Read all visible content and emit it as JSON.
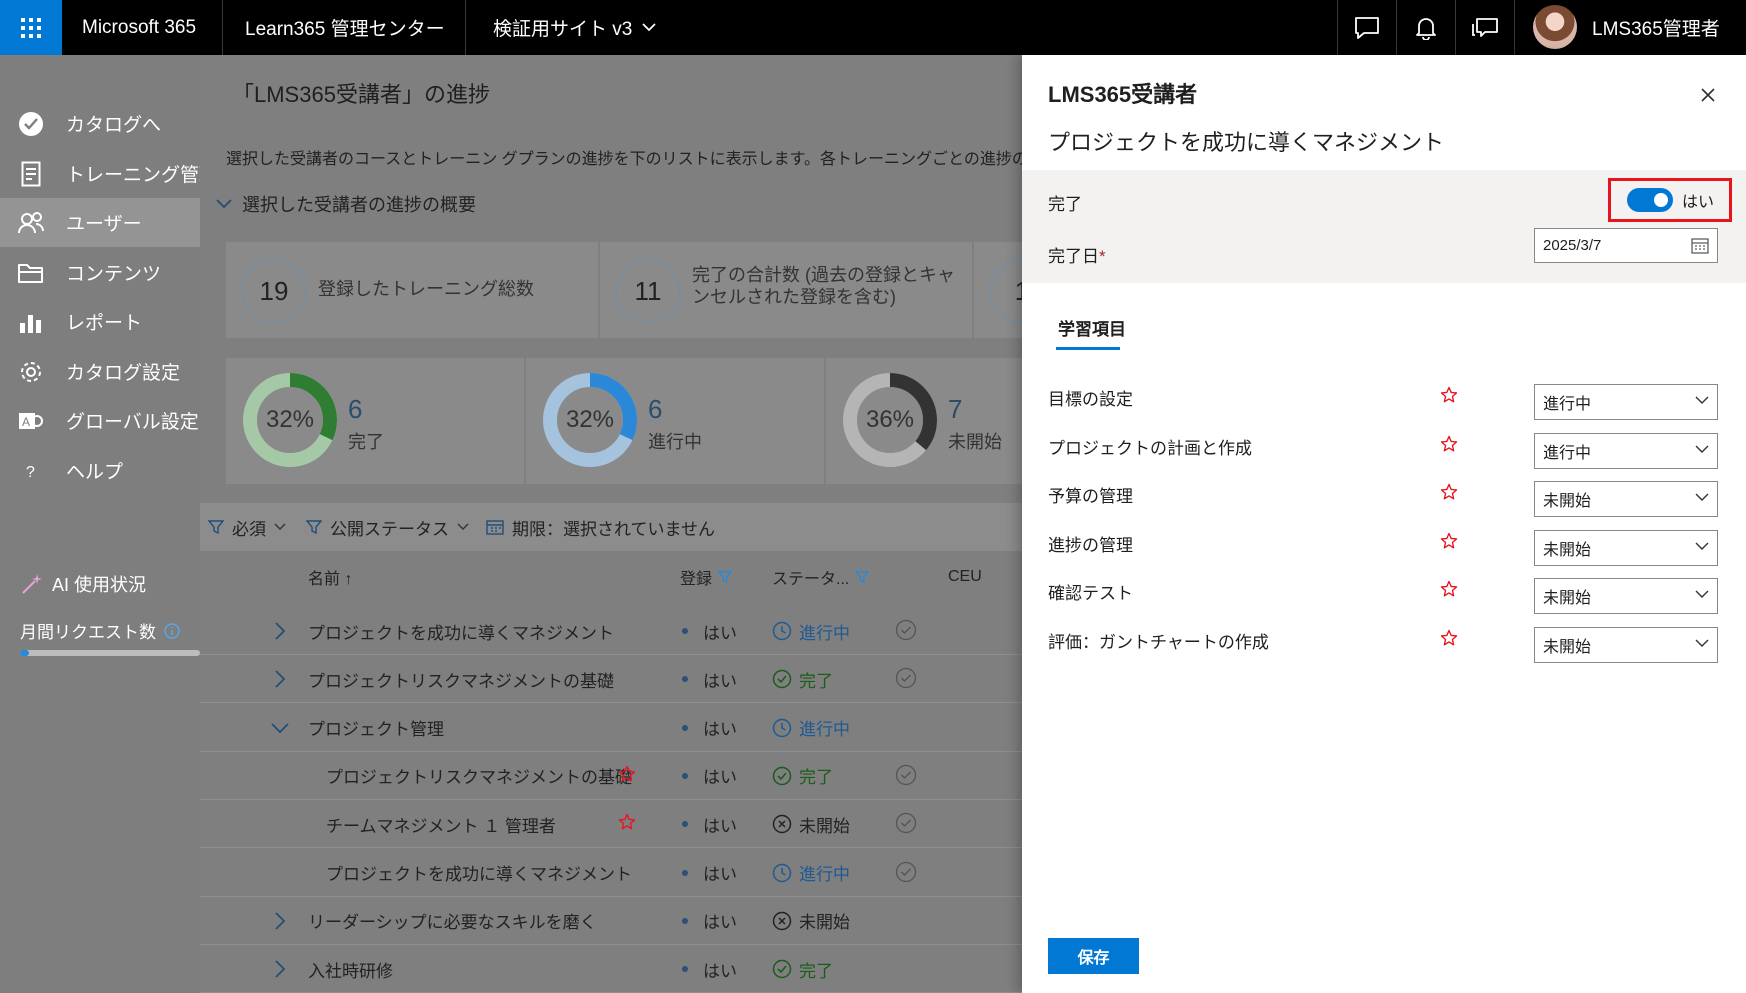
{
  "topbar": {
    "brand": "Microsoft 365",
    "app": "Learn365 管理センター",
    "site": "検証用サイト v3",
    "user": "LMS365管理者",
    "icons": [
      "waffle-icon",
      "chat-icon",
      "bell-icon",
      "feedback-icon"
    ]
  },
  "nav": {
    "items": [
      {
        "label": "カタログへ",
        "icon": "check-circle-icon"
      },
      {
        "label": "トレーニング管理",
        "icon": "document-icon"
      },
      {
        "label": "ユーザー",
        "icon": "users-icon"
      },
      {
        "label": "コンテンツ",
        "icon": "folder-icon"
      },
      {
        "label": "レポート",
        "icon": "bar-chart-icon"
      },
      {
        "label": "カタログ設定",
        "icon": "gear-icon"
      },
      {
        "label": "グローバル設定",
        "icon": "global-settings-icon"
      },
      {
        "label": "ヘルプ",
        "icon": "help-icon"
      }
    ],
    "ai_usage": "AI 使用状況",
    "monthly_requests": "月間リクエスト数",
    "monthly_requests_fraction": 0.05
  },
  "main": {
    "title": "「LMS365受講者」の進捗",
    "description": "選択した受講者のコースとトレーニン グプランの進捗を下のリストに表示します。各トレーニングごとの進捗の詳",
    "summary_toggle": "選択した受講者の進捗の概要",
    "stats": [
      {
        "value": "19",
        "label_line1": "登録したトレーニング総数",
        "label_line2": ""
      },
      {
        "value": "11",
        "label_line1": "完了の合計数 (過去の登録とキャ",
        "label_line2": "ンセルされた登録を含む)"
      },
      {
        "value": "1",
        "label_line1": "",
        "label_line2": ""
      }
    ],
    "donuts": [
      {
        "pct": "32%",
        "fraction": 0.32,
        "value": "6",
        "label": "完了",
        "color": "#2e7d32",
        "track": "#a5c9a7"
      },
      {
        "pct": "32%",
        "fraction": 0.32,
        "value": "6",
        "label": "進行中",
        "color": "#2b88d8",
        "track": "#a6c3dd"
      },
      {
        "pct": "36%",
        "fraction": 0.36,
        "value": "7",
        "label": "未開始",
        "color": "#333333",
        "track": "#b5b5b5"
      }
    ],
    "filters": {
      "required": "必須",
      "publish_status": "公開ステータス",
      "due": "期限：選択されていません"
    },
    "columns": {
      "name": "名前 ↑",
      "registered": "登録",
      "status": "ステータ...",
      "ceu": "CEU"
    },
    "rows": [
      {
        "name": "プロジェクトを成功に導くマネジメント",
        "registered": "はい",
        "status": "進行中",
        "status_type": "inprogress",
        "expand": "collapsed",
        "indent": 0,
        "star": false,
        "ceu": true
      },
      {
        "name": "プロジェクトリスクマネジメントの基礎",
        "registered": "はい",
        "status": "完了",
        "status_type": "complete",
        "expand": "collapsed",
        "indent": 0,
        "star": false,
        "ceu": true
      },
      {
        "name": "プロジェクト管理",
        "registered": "はい",
        "status": "進行中",
        "status_type": "inprogress",
        "expand": "expanded",
        "indent": 0,
        "star": false,
        "ceu": false
      },
      {
        "name": "プロジェクトリスクマネジメントの基礎",
        "registered": "はい",
        "status": "完了",
        "status_type": "complete",
        "expand": "none",
        "indent": 1,
        "star": true,
        "ceu": true
      },
      {
        "name": "チームマネジメント １ 管理者",
        "registered": "はい",
        "status": "未開始",
        "status_type": "notstarted",
        "expand": "none",
        "indent": 1,
        "star": true,
        "ceu": true
      },
      {
        "name": "プロジェクトを成功に導くマネジメント",
        "registered": "はい",
        "status": "進行中",
        "status_type": "inprogress",
        "expand": "none",
        "indent": 1,
        "star": false,
        "ceu": true
      },
      {
        "name": "リーダーシップに必要なスキルを磨く",
        "registered": "はい",
        "status": "未開始",
        "status_type": "notstarted",
        "expand": "collapsed",
        "indent": 0,
        "star": false,
        "ceu": false
      },
      {
        "name": "入社時研修",
        "registered": "はい",
        "status": "完了",
        "status_type": "complete",
        "expand": "collapsed",
        "indent": 0,
        "star": false,
        "ceu": false
      }
    ]
  },
  "panel": {
    "title": "LMS365受講者",
    "subtitle": "プロジェクトを成功に導くマネジメント",
    "complete_label": "完了",
    "complete_toggle_on": true,
    "complete_toggle_text": "はい",
    "date_label": "完了日",
    "required_mark": "*",
    "date_value": "2025/3/7",
    "tab_label": "学習項目",
    "items": [
      {
        "label": "目標の設定",
        "status": "進行中"
      },
      {
        "label": "プロジェクトの計画と作成",
        "status": "進行中"
      },
      {
        "label": "予算の管理",
        "status": "未開始"
      },
      {
        "label": "進捗の管理",
        "status": "未開始"
      },
      {
        "label": "確認テスト",
        "status": "未開始"
      },
      {
        "label": "評価：ガントチャートの作成",
        "status": "未開始"
      }
    ],
    "save_label": "保存"
  },
  "colors": {
    "accent": "#0078d4",
    "highlight_box": "#e8141c",
    "required_star": "#e8141c",
    "complete_green": "#107c10"
  }
}
